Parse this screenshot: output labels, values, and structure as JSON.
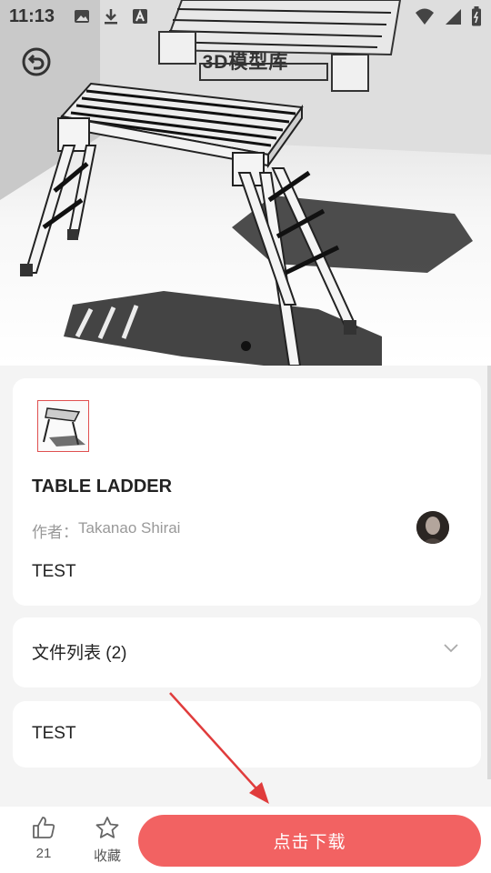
{
  "status_bar": {
    "time": "11:13",
    "left_icons": [
      "image-icon",
      "download-icon",
      "a-box-icon"
    ],
    "right_icons": [
      "wifi-icon",
      "signal-icon",
      "battery-icon"
    ]
  },
  "header": {
    "title": "3D模型库",
    "back_icon": "back-arrow-circle-icon"
  },
  "carousel": {
    "active_index": 0,
    "dot_count": 1
  },
  "model": {
    "title": "TABLE LADDER",
    "author_prefix": "作者：",
    "author_name": "Takanao Shirai",
    "description": "TEST"
  },
  "files": {
    "label": "文件列表 (2)"
  },
  "extra": {
    "text": "TEST"
  },
  "bottom": {
    "like_count": "21",
    "favorite_label": "收藏",
    "download_label": "点击下载"
  },
  "colors": {
    "accent": "#f26262",
    "annotation": "#e03c3c",
    "background": "#f4f4f4"
  }
}
